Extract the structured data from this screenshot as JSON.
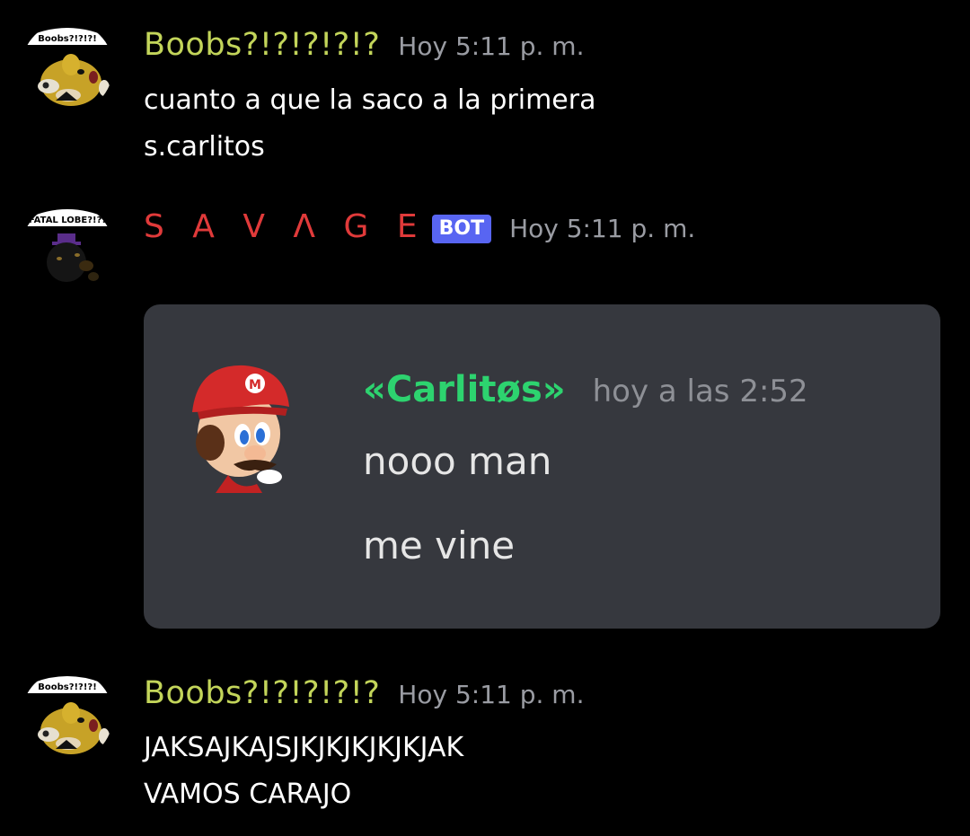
{
  "messages": [
    {
      "author": "Boobs?!?!?!?!?",
      "avatar_caption": "Boobs?!?!?!",
      "timestamp": "Hoy 5:11 p. m.",
      "lines": [
        "cuanto a que la saco a la primera",
        "s.carlitos"
      ]
    },
    {
      "author": "S A V Λ G E",
      "avatar_caption": "FATAL LOBE?!?!",
      "badge": "BOT",
      "timestamp": "Hoy 5:11 p. m.",
      "embed": {
        "author": "«Carlitøs»",
        "timestamp": "hoy a las 2:52",
        "lines": [
          "nooo man",
          "me vine"
        ]
      }
    },
    {
      "author": "Boobs?!?!?!?!?",
      "avatar_caption": "Boobs?!?!?!",
      "timestamp": "Hoy 5:11 p. m.",
      "lines": [
        "JAKSAJKAJSJKJKJKJKJKJAK",
        "VAMOS CARAJO"
      ]
    }
  ],
  "colors": {
    "background": "#000000",
    "username_green": "#c3d55a",
    "username_red": "#e03a3a",
    "bot_badge": "#5865f2",
    "embed_background": "#36383e",
    "embed_author": "#2dd36f"
  },
  "icons": {
    "avatar_1": "chica-avatar-icon",
    "avatar_2": "dark-animatronic-avatar-icon",
    "embed_avatar": "mario-head-icon"
  }
}
